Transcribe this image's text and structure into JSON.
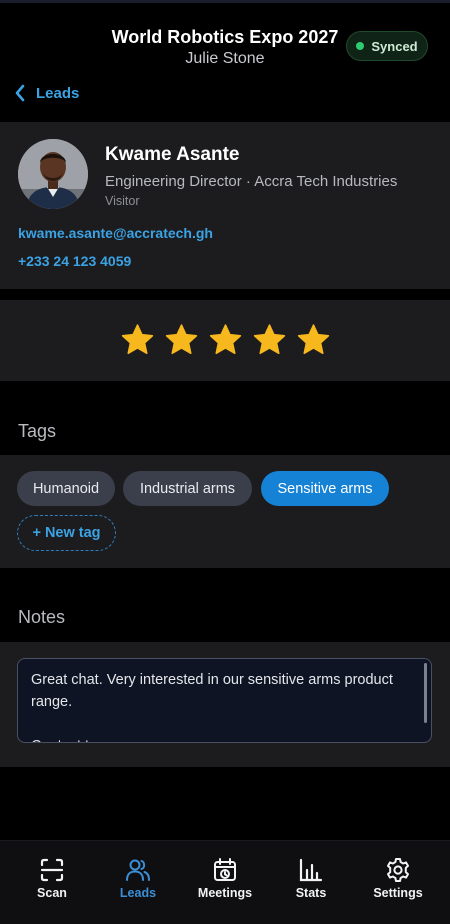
{
  "header": {
    "event_title": "World Robotics Expo 2027",
    "user_name": "Julie Stone",
    "sync_status": "Synced",
    "back_label": "Leads"
  },
  "contact": {
    "name": "Kwame Asante",
    "role_company": "Engineering Director · Accra Tech Industries",
    "type": "Visitor",
    "email": "kwame.asante@accratech.gh",
    "phone": "+233 24 123 4059"
  },
  "rating": {
    "value": 5,
    "max": 5,
    "color": "#f7b81d"
  },
  "tags": {
    "heading": "Tags",
    "items": [
      {
        "label": "Humanoid",
        "selected": false
      },
      {
        "label": "Industrial arms",
        "selected": false
      },
      {
        "label": "Sensitive arms",
        "selected": true
      }
    ],
    "new_tag_label": "+ New tag"
  },
  "notes": {
    "heading": "Notes",
    "text": "Great chat. Very interested in our sensitive arms product range.\n\nContact tomorrow"
  },
  "nav": {
    "items": [
      {
        "label": "Scan",
        "icon": "scan-icon",
        "active": false
      },
      {
        "label": "Leads",
        "icon": "users-icon",
        "active": true
      },
      {
        "label": "Meetings",
        "icon": "calendar-clock-icon",
        "active": false
      },
      {
        "label": "Stats",
        "icon": "bar-chart-icon",
        "active": false
      },
      {
        "label": "Settings",
        "icon": "gear-icon",
        "active": false
      }
    ]
  },
  "colors": {
    "accent": "#3ba3e4",
    "active_tag": "#1582d6",
    "synced_dot": "#2ecc71",
    "star": "#f7b81d"
  }
}
